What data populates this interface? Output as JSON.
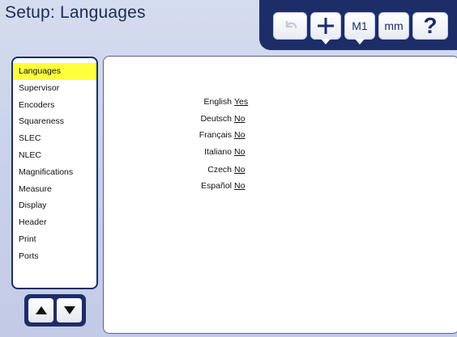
{
  "window": {
    "title": "Setup: Languages"
  },
  "toolbar": {
    "buttons": [
      {
        "name": "undo",
        "icon": "undo-arrow-icon"
      },
      {
        "name": "add",
        "icon": "plus-icon"
      },
      {
        "name": "m1",
        "label": "M1"
      },
      {
        "name": "units",
        "label": "mm"
      },
      {
        "name": "help",
        "label": "?"
      }
    ]
  },
  "sidebar": {
    "items": [
      {
        "label": "Languages",
        "active": true
      },
      {
        "label": "Supervisor"
      },
      {
        "label": "Encoders"
      },
      {
        "label": "Squareness"
      },
      {
        "label": "SLEC"
      },
      {
        "label": "NLEC"
      },
      {
        "label": "Magnifications"
      },
      {
        "label": "Measure"
      },
      {
        "label": "Display"
      },
      {
        "label": "Header"
      },
      {
        "label": "Print"
      },
      {
        "label": "Ports"
      }
    ],
    "scroll": {
      "up_icon": "triangle-up-icon",
      "down_icon": "triangle-down-icon"
    }
  },
  "languages": [
    {
      "label": "English",
      "value": "Yes"
    },
    {
      "label": "Deutsch",
      "value": "No"
    },
    {
      "label": "Français",
      "value": "No"
    },
    {
      "label": "Italiano",
      "value": "No"
    },
    {
      "label": "Czech",
      "value": "No"
    },
    {
      "label": "Español",
      "value": "No"
    }
  ],
  "colors": {
    "navy": "#1d2d67",
    "highlight": "#ffff3c",
    "background": "#c9d1ea"
  }
}
